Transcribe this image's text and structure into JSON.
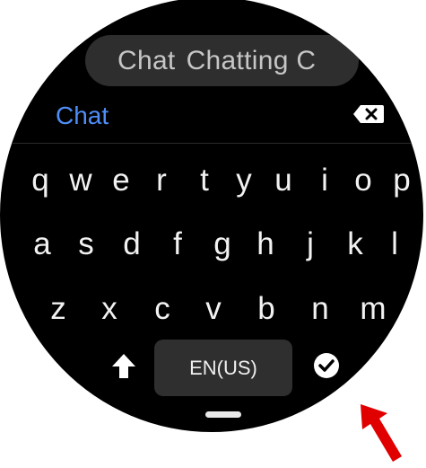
{
  "suggestions": [
    "Chat",
    "Chatting C"
  ],
  "compose_text": "Chat",
  "keyboard": {
    "row1": [
      "q",
      "w",
      "e",
      "r",
      "t",
      "y",
      "u",
      "i",
      "o",
      "p"
    ],
    "row2": [
      "a",
      "s",
      "d",
      "f",
      "g",
      "h",
      "j",
      "k",
      "l"
    ],
    "row3": [
      "z",
      "x",
      "c",
      "v",
      "b",
      "n",
      "m"
    ],
    "space_label": "EN(US)"
  },
  "icons": {
    "backspace": "backspace-icon",
    "shift": "shift-arrow-icon",
    "enter": "check-circle-icon",
    "annotation": "red-arrow-icon"
  },
  "colors": {
    "background": "#000000",
    "accent_text": "#4f8ef7",
    "key_text": "#f2f2f2",
    "suggestion_bg": "#2e2e2e",
    "annotation": "#e00000"
  }
}
